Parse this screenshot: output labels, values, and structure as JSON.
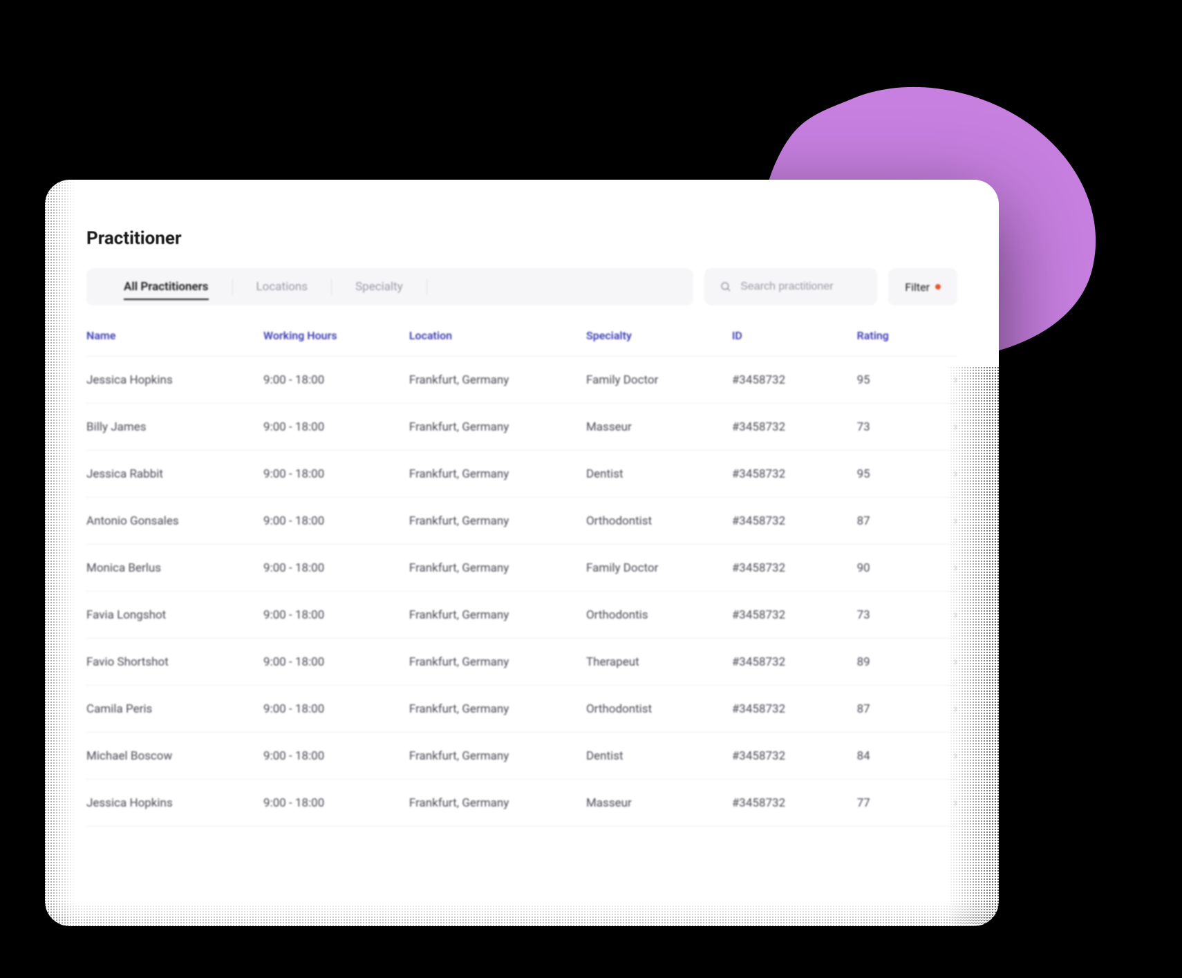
{
  "page": {
    "title": "Practitioner"
  },
  "tabs": {
    "items": [
      {
        "label": "All Practitioners",
        "active": true
      },
      {
        "label": "Locations",
        "active": false
      },
      {
        "label": "Specialty",
        "active": false
      }
    ]
  },
  "search": {
    "placeholder": "Search practitioner"
  },
  "filter": {
    "label": "Filter"
  },
  "table": {
    "columns": [
      "Name",
      "Working Hours",
      "Location",
      "Specialty",
      "ID",
      "Rating"
    ],
    "rows": [
      {
        "name": "Jessica Hopkins",
        "hours": "9:00 - 18:00",
        "location": "Frankfurt, Germany",
        "specialty": "Family Doctor",
        "id": "#3458732",
        "rating": "95"
      },
      {
        "name": "Billy James",
        "hours": "9:00 - 18:00",
        "location": "Frankfurt, Germany",
        "specialty": "Masseur",
        "id": "#3458732",
        "rating": "73"
      },
      {
        "name": "Jessica Rabbit",
        "hours": "9:00 - 18:00",
        "location": "Frankfurt, Germany",
        "specialty": "Dentist",
        "id": "#3458732",
        "rating": "95"
      },
      {
        "name": "Antonio Gonsales",
        "hours": "9:00 - 18:00",
        "location": "Frankfurt, Germany",
        "specialty": "Orthodontist",
        "id": "#3458732",
        "rating": "87"
      },
      {
        "name": "Monica Berlus",
        "hours": "9:00 - 18:00",
        "location": "Frankfurt, Germany",
        "specialty": "Family Doctor",
        "id": "#3458732",
        "rating": "90"
      },
      {
        "name": "Favia Longshot",
        "hours": "9:00 - 18:00",
        "location": "Frankfurt, Germany",
        "specialty": "Orthodontis",
        "id": "#3458732",
        "rating": "73"
      },
      {
        "name": "Favio Shortshot",
        "hours": "9:00 - 18:00",
        "location": "Frankfurt, Germany",
        "specialty": "Therapeut",
        "id": "#3458732",
        "rating": "89"
      },
      {
        "name": "Camila Peris",
        "hours": "9:00 - 18:00",
        "location": "Frankfurt, Germany",
        "specialty": "Orthodontist",
        "id": "#3458732",
        "rating": "87"
      },
      {
        "name": "Michael Boscow",
        "hours": "9:00 - 18:00",
        "location": "Frankfurt, Germany",
        "specialty": "Dentist",
        "id": "#3458732",
        "rating": "84"
      },
      {
        "name": "Jessica Hopkins",
        "hours": "9:00 - 18:00",
        "location": "Frankfurt, Germany",
        "specialty": "Masseur",
        "id": "#3458732",
        "rating": "77"
      }
    ]
  },
  "colors": {
    "accent_purple": "#c77fe0",
    "header_link": "#3f3fb5",
    "filter_dot": "#e4572e"
  }
}
